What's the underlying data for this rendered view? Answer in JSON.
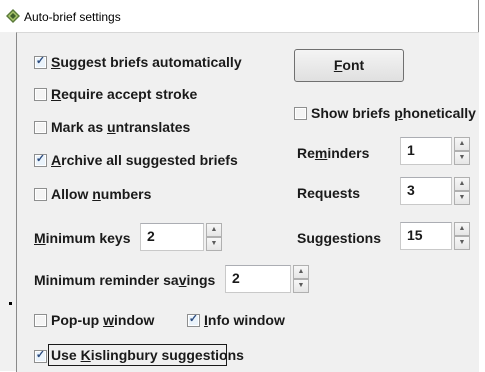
{
  "window": {
    "title": "Auto-brief settings"
  },
  "checkboxes": {
    "suggest_briefs": {
      "pre": "",
      "key": "S",
      "post": "uggest briefs automatically",
      "checked": true
    },
    "require_accept": {
      "pre": "",
      "key": "R",
      "post": "equire accept stroke",
      "checked": false
    },
    "mark_untranslates": {
      "pre": "Mark as ",
      "key": "u",
      "post": "ntranslates",
      "checked": false
    },
    "archive_briefs": {
      "pre": "",
      "key": "A",
      "post": "rchive all suggested briefs",
      "checked": true
    },
    "allow_numbers": {
      "pre": "Allow ",
      "key": "n",
      "post": "umbers",
      "checked": false
    },
    "show_phonetically": {
      "pre": "Show briefs ",
      "key": "p",
      "post": "honetically",
      "checked": false
    },
    "popup_window": {
      "pre": "Pop-up ",
      "key": "w",
      "post": "indow",
      "checked": false
    },
    "info_window": {
      "pre": "",
      "key": "I",
      "post": "nfo window",
      "checked": true
    },
    "kislingbury": {
      "pre": "Use ",
      "key": "K",
      "post": "islingbury suggestions",
      "checked": true
    }
  },
  "buttons": {
    "font": {
      "key": "F",
      "post": "ont"
    }
  },
  "fields": {
    "minimum_keys": {
      "pre": "",
      "key": "M",
      "post": "inimum keys",
      "value": "2"
    },
    "minimum_reminder_savings": {
      "pre": "Minimum reminder sa",
      "key": "v",
      "post": "ings",
      "value": "2"
    },
    "reminders": {
      "pre": "Re",
      "key": "m",
      "post": "inders",
      "value": "1"
    },
    "requests": {
      "pre": "Requests",
      "key": "",
      "post": "",
      "value": "3"
    },
    "suggestions": {
      "pre": "Suggestions",
      "key": "",
      "post": "",
      "value": "15"
    }
  },
  "icons": {
    "app": "diamond-app-icon",
    "check": "checkmark-icon",
    "spin_up": "triangle-up-icon",
    "spin_down": "triangle-down-icon"
  }
}
